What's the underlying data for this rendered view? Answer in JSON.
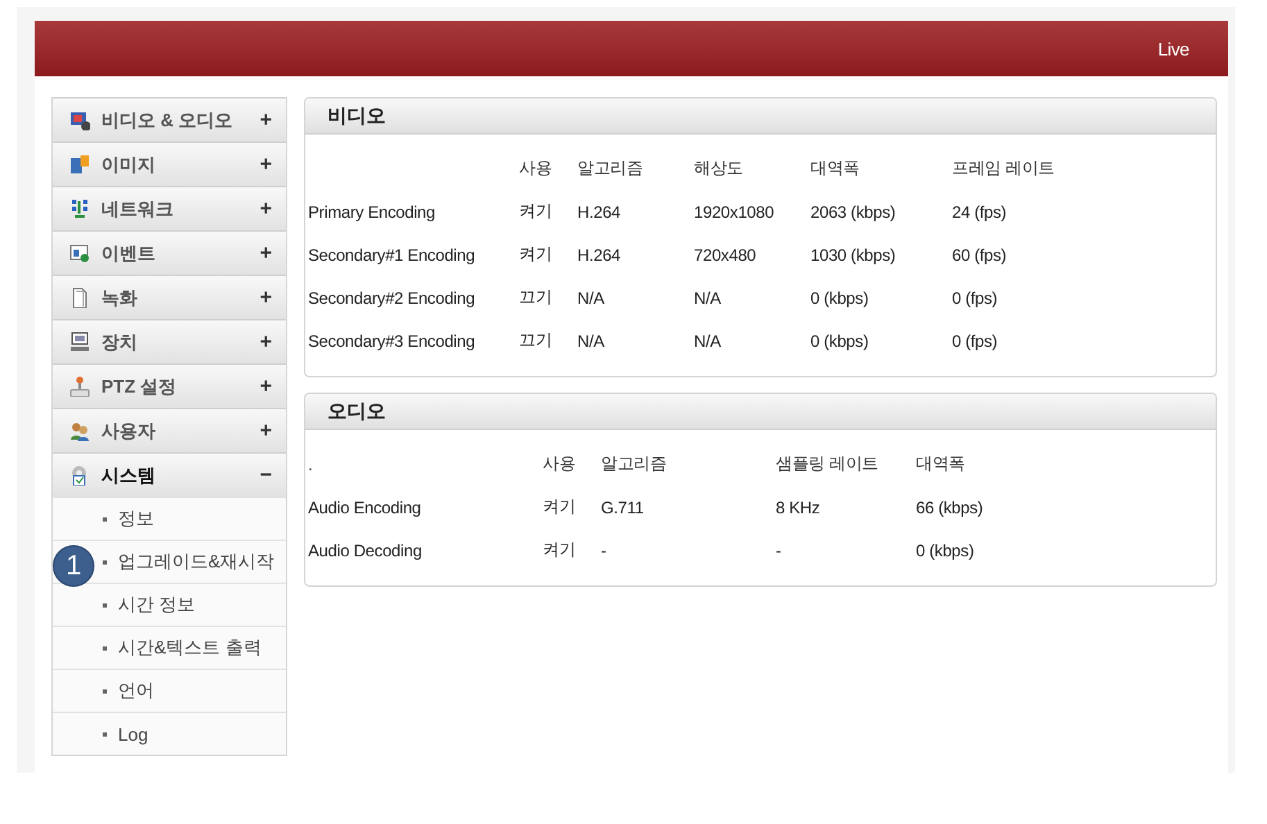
{
  "header": {
    "live_link": "Live"
  },
  "sidebar": {
    "items": [
      {
        "label": "비디오 & 오디오",
        "expanded": false
      },
      {
        "label": "이미지",
        "expanded": false
      },
      {
        "label": "네트워크",
        "expanded": false
      },
      {
        "label": "이벤트",
        "expanded": false
      },
      {
        "label": "녹화",
        "expanded": false
      },
      {
        "label": "장치",
        "expanded": false
      },
      {
        "label": "PTZ 설정",
        "expanded": false
      },
      {
        "label": "사용자",
        "expanded": false
      },
      {
        "label": "시스템",
        "expanded": true,
        "children": [
          {
            "label": "정보"
          },
          {
            "label": "업그레이드&재시작",
            "callout": "1"
          },
          {
            "label": "시간 정보"
          },
          {
            "label": "시간&텍스트 출력"
          },
          {
            "label": "언어"
          },
          {
            "label": "Log"
          }
        ]
      }
    ]
  },
  "expand_signs": {
    "collapsed": "+",
    "expanded": "−"
  },
  "panels": [
    {
      "title": "비디오",
      "columns": [
        "",
        "사용",
        "알고리즘",
        "해상도",
        "대역폭",
        "프레임 레이트"
      ],
      "rows": [
        [
          "Primary Encoding",
          "켜기",
          "H.264",
          "1920x1080",
          "2063 (kbps)",
          "24 (fps)"
        ],
        [
          "Secondary#1 Encoding",
          "켜기",
          "H.264",
          "720x480",
          "1030 (kbps)",
          "60 (fps)"
        ],
        [
          "Secondary#2 Encoding",
          "끄기",
          "N/A",
          "N/A",
          "0 (kbps)",
          "0 (fps)"
        ],
        [
          "Secondary#3 Encoding",
          "끄기",
          "N/A",
          "N/A",
          "0 (kbps)",
          "0 (fps)"
        ]
      ]
    },
    {
      "title": "오디오",
      "columns": [
        ".",
        "사용",
        "알고리즘",
        "샘플링 레이트",
        "대역폭"
      ],
      "rows": [
        [
          "Audio Encoding",
          "켜기",
          "G.711",
          "8 KHz",
          "66 (kbps)"
        ],
        [
          "Audio Decoding",
          "켜기",
          "-",
          "-",
          "0 (kbps)"
        ]
      ]
    }
  ]
}
